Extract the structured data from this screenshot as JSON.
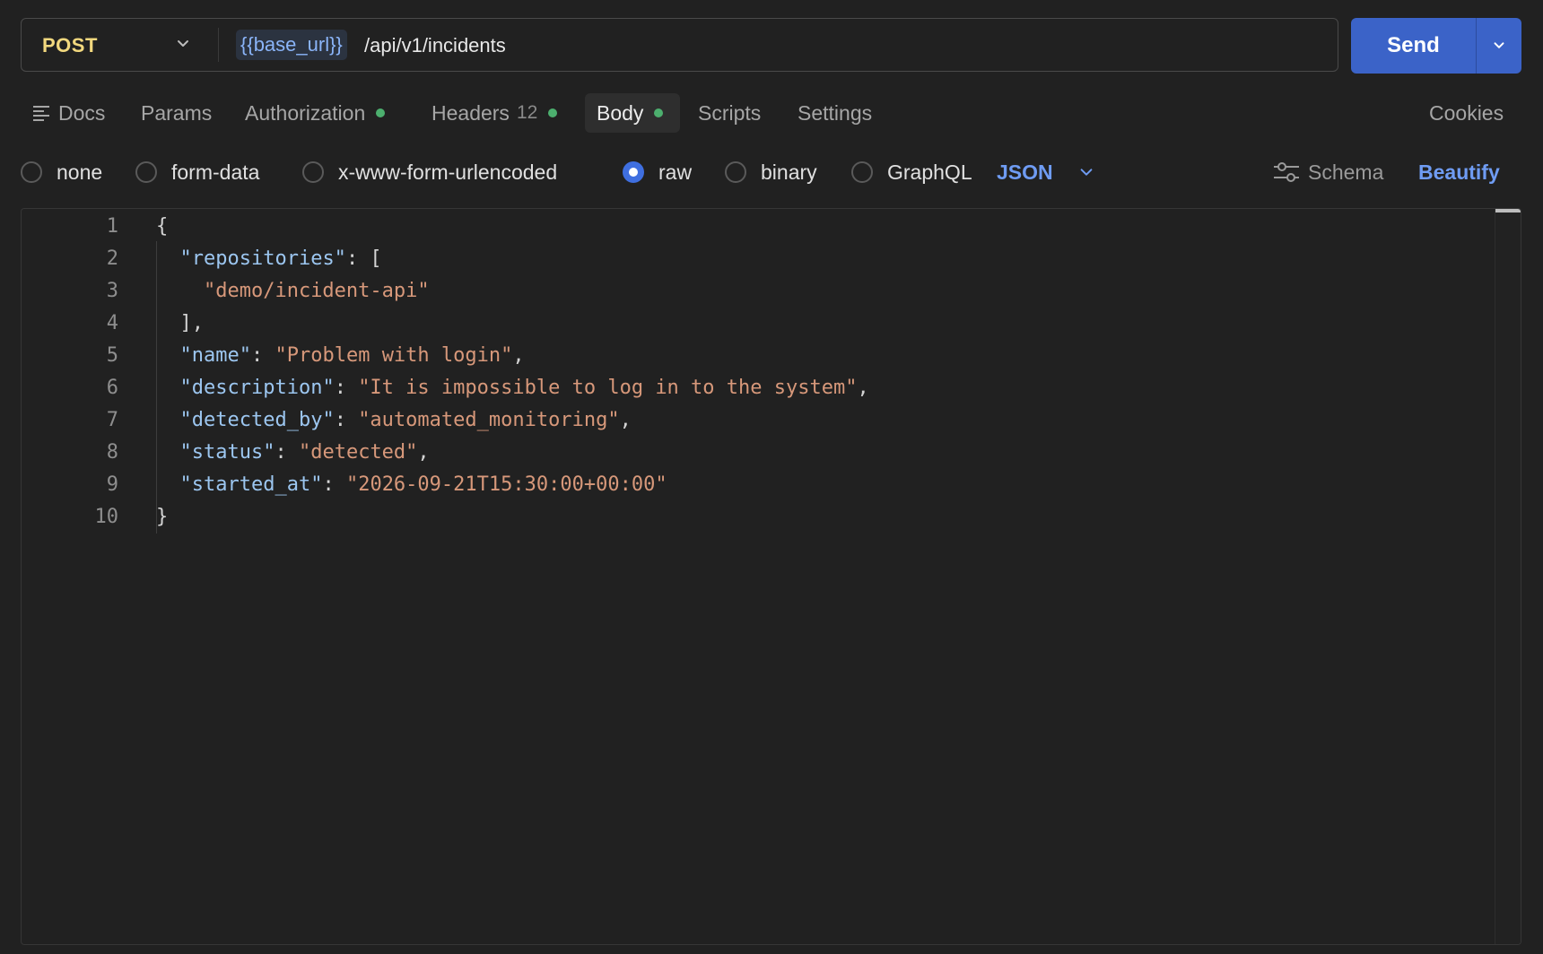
{
  "request": {
    "method": "POST",
    "url_variable": "{{base_url}}",
    "url_path": "/api/v1/incidents",
    "send_label": "Send"
  },
  "tabs": {
    "docs": "Docs",
    "params": "Params",
    "authorization": "Authorization",
    "headers": "Headers",
    "headers_count": "12",
    "body": "Body",
    "scripts": "Scripts",
    "settings": "Settings",
    "cookies": "Cookies",
    "active": "Body"
  },
  "body_options": {
    "types": [
      "none",
      "form-data",
      "x-www-form-urlencoded",
      "raw",
      "binary",
      "GraphQL"
    ],
    "selected": "raw",
    "format": "JSON",
    "schema_label": "Schema",
    "beautify_label": "Beautify"
  },
  "editor": {
    "lines": [
      [
        {
          "t": "p",
          "v": "{"
        }
      ],
      [
        {
          "t": "p",
          "v": "  "
        },
        {
          "t": "k",
          "v": "\"repositories\""
        },
        {
          "t": "p",
          "v": ": ["
        }
      ],
      [
        {
          "t": "p",
          "v": "    "
        },
        {
          "t": "s",
          "v": "\"demo/incident-api\""
        }
      ],
      [
        {
          "t": "p",
          "v": "  ],"
        }
      ],
      [
        {
          "t": "p",
          "v": "  "
        },
        {
          "t": "k",
          "v": "\"name\""
        },
        {
          "t": "p",
          "v": ": "
        },
        {
          "t": "s",
          "v": "\"Problem with login\""
        },
        {
          "t": "p",
          "v": ","
        }
      ],
      [
        {
          "t": "p",
          "v": "  "
        },
        {
          "t": "k",
          "v": "\"description\""
        },
        {
          "t": "p",
          "v": ": "
        },
        {
          "t": "s",
          "v": "\"It is impossible to log in to the system\""
        },
        {
          "t": "p",
          "v": ","
        }
      ],
      [
        {
          "t": "p",
          "v": "  "
        },
        {
          "t": "k",
          "v": "\"detected_by\""
        },
        {
          "t": "p",
          "v": ": "
        },
        {
          "t": "s",
          "v": "\"automated_monitoring\""
        },
        {
          "t": "p",
          "v": ","
        }
      ],
      [
        {
          "t": "p",
          "v": "  "
        },
        {
          "t": "k",
          "v": "\"status\""
        },
        {
          "t": "p",
          "v": ": "
        },
        {
          "t": "s",
          "v": "\"detected\""
        },
        {
          "t": "p",
          "v": ","
        }
      ],
      [
        {
          "t": "p",
          "v": "  "
        },
        {
          "t": "k",
          "v": "\"started_at\""
        },
        {
          "t": "p",
          "v": ": "
        },
        {
          "t": "s",
          "v": "\"2026-09-21T15:30:00+00:00\""
        }
      ],
      [
        {
          "t": "p",
          "v": "}"
        }
      ]
    ]
  },
  "colors": {
    "method": "#f2d87e",
    "send_button": "#3b63c8",
    "status_dot": "#4caf6e",
    "accent_link": "#6f9cf3",
    "json_key": "#9cc6f0",
    "json_string": "#d7987a"
  },
  "icons": {
    "method_dropdown": "chevron-down-icon",
    "send_dropdown": "chevron-down-icon",
    "docs": "docs-lines-icon",
    "schema": "sliders-icon",
    "format_dropdown": "chevron-down-icon"
  }
}
